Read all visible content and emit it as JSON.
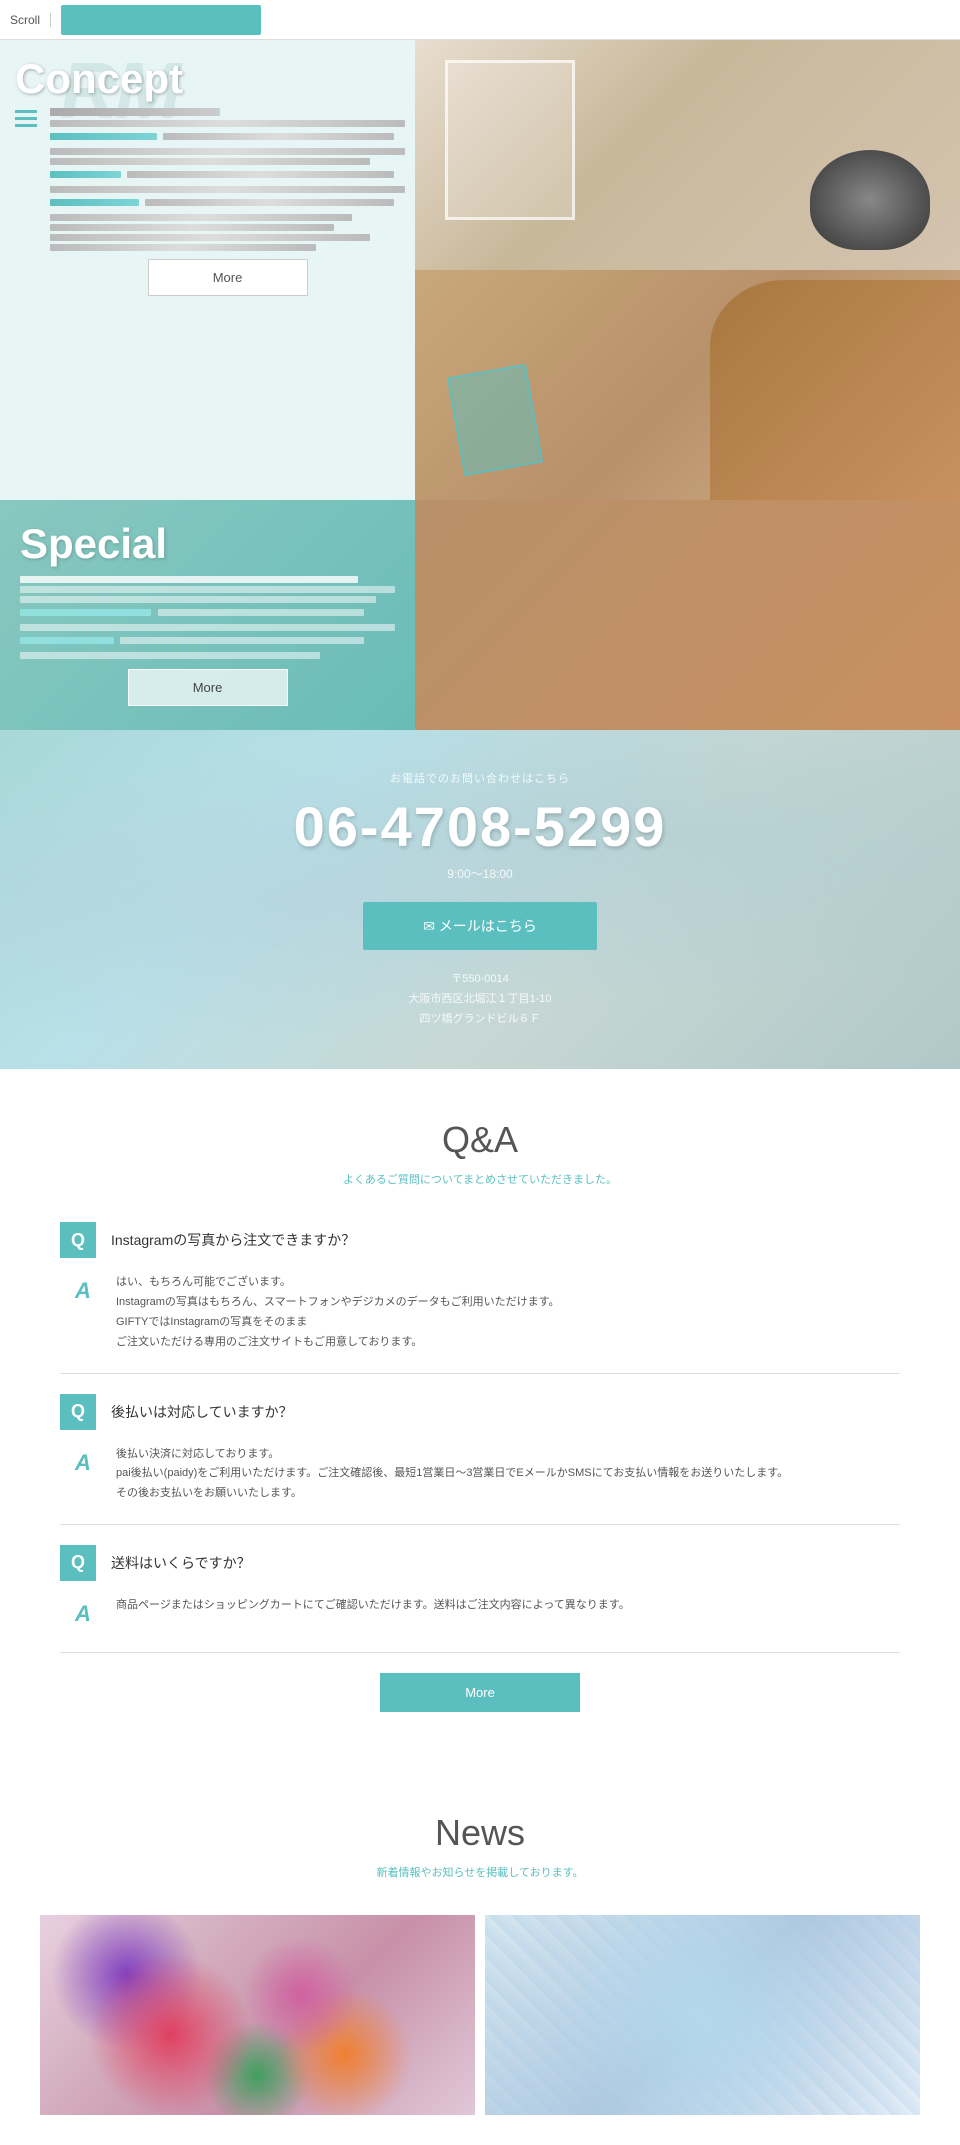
{
  "topbar": {
    "scroll_label": "Scroll",
    "nav_placeholder": ""
  },
  "hero": {
    "concept_title": "Concept",
    "concept_title_bg": "RM",
    "more_button": "More",
    "special_title": "Special",
    "special_more_button": "More"
  },
  "contact": {
    "subtitle": "お電話でのお問い合わせはこちら",
    "phone": "06-4708-5299",
    "hours": "9:00〜18:00",
    "email_button": "✉  メールはこちら",
    "address_zip": "〒550-0014",
    "address_line1": "大阪市西区北堀江１丁目1-10",
    "address_line2": "四ツ橋グランドビル６Ｆ"
  },
  "qa": {
    "title": "Q&A",
    "subtitle": "よくあるご質問についてまとめさせていただきました。",
    "q_icon": "Q",
    "a_icon": "A",
    "items": [
      {
        "question": "Instagramの写真から注文できますか？",
        "answer": "はい、もちろん可能でございます。\nInstagramの写真はもちろん、スマートフォンやデジカメのデータもご利用いただけます。\nGIFTYではInstagramの写真をそのまま\nご注文いただける専用のご注文サイトもご用意しております。"
      },
      {
        "question": "後払いは対応していますか？",
        "answer": "後払い決済に対応しております。\npai後払い(paidy)をご利用いただけます。ご注文確認後、最短1営業日〜3営業日でEメールかSMSにてお支払い情報をお送りいたします。\nその後お支払いをお願いいたします。"
      },
      {
        "question": "送料はいくらですか？",
        "answer": "商品ページまたはショッピングカートにてご確認いただけます。送料はご注文内容によって異なります。"
      }
    ],
    "more_button": "More"
  },
  "news": {
    "title": "News",
    "subtitle": "新着情報やお知らせを掲載しております。"
  }
}
